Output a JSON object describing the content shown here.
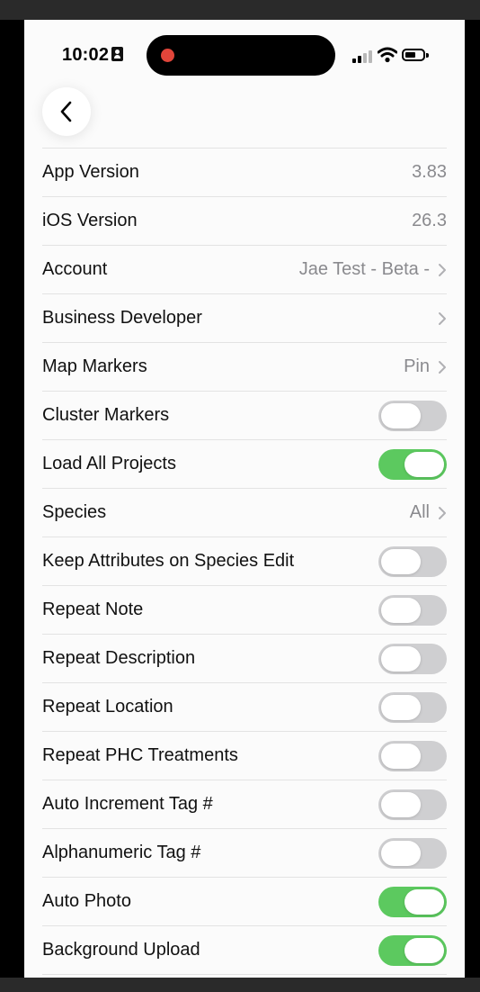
{
  "status_bar": {
    "time": "10:02",
    "icons": [
      "person-badge-icon",
      "cellular-signal-icon",
      "wifi-icon",
      "battery-icon"
    ],
    "recording_color": "#e0453a"
  },
  "nav": {
    "back_icon": "chevron-left-icon"
  },
  "colors": {
    "toggle_on": "#5cc95f",
    "toggle_off": "#cfcfd1",
    "value_text": "#8a8a8e"
  },
  "settings": [
    {
      "label": "App Version",
      "value": "3.83",
      "type": "value"
    },
    {
      "label": "iOS Version",
      "value": "26.3",
      "type": "value"
    },
    {
      "label": "Account",
      "value": "Jae Test - Beta -",
      "type": "link"
    },
    {
      "label": "Business Developer",
      "value": "",
      "type": "link"
    },
    {
      "label": "Map Markers",
      "value": "Pin",
      "type": "link"
    },
    {
      "label": "Cluster Markers",
      "type": "toggle",
      "on": false
    },
    {
      "label": "Load All Projects",
      "type": "toggle",
      "on": true
    },
    {
      "label": "Species",
      "value": "All",
      "type": "link"
    },
    {
      "label": "Keep Attributes on Species Edit",
      "type": "toggle",
      "on": false
    },
    {
      "label": "Repeat Note",
      "type": "toggle",
      "on": false
    },
    {
      "label": "Repeat Description",
      "type": "toggle",
      "on": false
    },
    {
      "label": "Repeat Location",
      "type": "toggle",
      "on": false
    },
    {
      "label": "Repeat PHC Treatments",
      "type": "toggle",
      "on": false
    },
    {
      "label": "Auto Increment Tag #",
      "type": "toggle",
      "on": false
    },
    {
      "label": "Alphanumeric Tag #",
      "type": "toggle",
      "on": false
    },
    {
      "label": "Auto Photo",
      "type": "toggle",
      "on": true
    },
    {
      "label": "Background Upload",
      "type": "toggle",
      "on": true
    }
  ]
}
